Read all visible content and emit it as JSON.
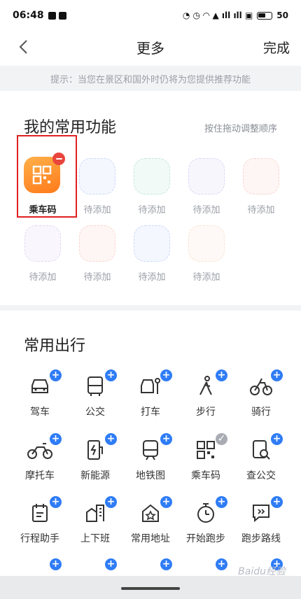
{
  "status_bar": {
    "time": "06:48",
    "battery": "50"
  },
  "nav": {
    "title": "更多",
    "done_label": "完成"
  },
  "tip": "提示：当您在景区和国外时仍将为您提供推荐功能",
  "my_functions": {
    "title": "我的常用功能",
    "hint": "按住拖动调整顺序",
    "items": [
      {
        "label": "乘车码",
        "filled": true
      },
      {
        "label": "待添加",
        "color": "#c9d8f8"
      },
      {
        "label": "待添加",
        "color": "#bfe8d8"
      },
      {
        "label": "待添加",
        "color": "#dcd4f6"
      },
      {
        "label": "待添加",
        "color": "#fad4cc"
      },
      {
        "label": "待添加",
        "color": "#e2d6f4"
      },
      {
        "label": "待添加",
        "color": "#fad4cc"
      },
      {
        "label": "待添加",
        "color": "#c9d8f8"
      },
      {
        "label": "待添加",
        "color": "#fae3d0"
      }
    ]
  },
  "travel": {
    "title": "常用出行",
    "items": [
      {
        "label": "驾车",
        "icon": "car-icon"
      },
      {
        "label": "公交",
        "icon": "bus-icon"
      },
      {
        "label": "打车",
        "icon": "taxi-icon"
      },
      {
        "label": "步行",
        "icon": "walk-icon"
      },
      {
        "label": "骑行",
        "icon": "bike-icon"
      },
      {
        "label": "摩托车",
        "icon": "motorcycle-icon"
      },
      {
        "label": "新能源",
        "icon": "ev-charging-icon"
      },
      {
        "label": "地铁图",
        "icon": "metro-icon"
      },
      {
        "label": "乘车码",
        "icon": "qr-code-icon",
        "added": true
      },
      {
        "label": "查公交",
        "icon": "bus-search-icon"
      },
      {
        "label": "行程助手",
        "icon": "calendar-icon"
      },
      {
        "label": "上下班",
        "icon": "commute-icon"
      },
      {
        "label": "常用地址",
        "icon": "home-star-icon"
      },
      {
        "label": "开始跑步",
        "icon": "stopwatch-icon"
      },
      {
        "label": "跑步路线",
        "icon": "route-icon"
      }
    ]
  },
  "watermark": "Baidu经验"
}
